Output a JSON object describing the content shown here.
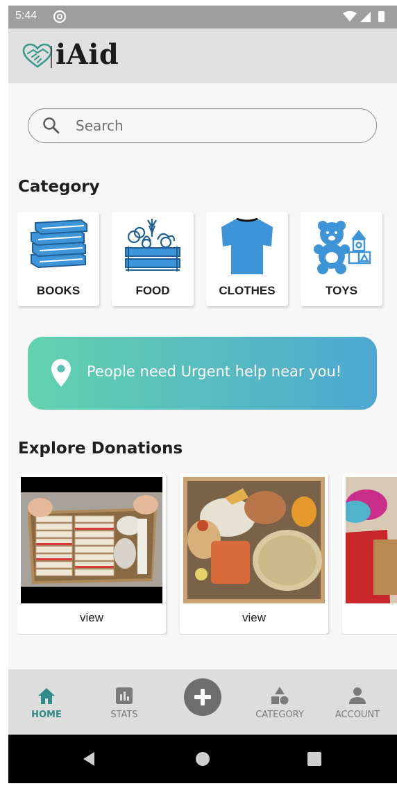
{
  "status_bar": {
    "time": "5:44"
  },
  "app_bar": {
    "title": "iAid",
    "logo_icon": "heart-handshake-icon"
  },
  "search": {
    "placeholder": "Search",
    "icon": "search-icon"
  },
  "category_section": {
    "title": "Category",
    "items": [
      {
        "label": "BOOKS",
        "icon": "books-icon"
      },
      {
        "label": "FOOD",
        "icon": "food-crate-icon"
      },
      {
        "label": "CLOTHES",
        "icon": "tshirt-icon"
      },
      {
        "label": "TOYS",
        "icon": "teddy-bear-icon"
      }
    ]
  },
  "urgent_banner": {
    "text": "People need Urgent help near you!",
    "icon": "location-pin-icon",
    "gradient": [
      "#62d3ad",
      "#4ea7d1"
    ]
  },
  "donations_section": {
    "title": "Explore Donations",
    "items": [
      {
        "label": "view",
        "image": "books-box-photo"
      },
      {
        "label": "view",
        "image": "food-box-photo"
      },
      {
        "label": "",
        "image": "clothes-photo"
      }
    ]
  },
  "bottom_nav": {
    "items": [
      {
        "label": "HOME",
        "icon": "home-icon",
        "active": true
      },
      {
        "label": "STATS",
        "icon": "bar-chart-icon",
        "active": false
      },
      {
        "label": "CATEGORY",
        "icon": "shapes-icon",
        "active": false
      },
      {
        "label": "ACCOUNT",
        "icon": "person-icon",
        "active": false
      }
    ],
    "fab_icon": "plus-icon"
  },
  "colors": {
    "accent": "#2f8c86",
    "category_icon": "#3d94d6",
    "nav_inactive": "#7a7a7a"
  }
}
